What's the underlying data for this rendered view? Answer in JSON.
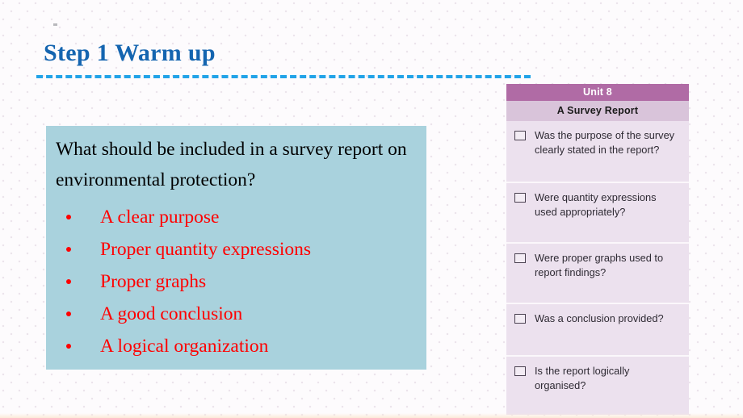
{
  "slide": {
    "title": "Step 1 Warm up",
    "colors": {
      "title_blue": "#1565b0",
      "rule_blue": "#22a3e8",
      "question_box_bg": "#a9d2dd",
      "bullet_red": "#ff0000",
      "panel_header_purple": "#b06ba5",
      "panel_subtitle_purple": "#d9c4da",
      "panel_body_purple": "#ece1ee"
    }
  },
  "question_box": {
    "question": "What should be included in a survey report on environmental protection?",
    "bullets": [
      "A clear purpose",
      "Proper quantity expressions",
      "Proper graphs",
      "A good conclusion",
      "A logical organization"
    ]
  },
  "checklist": {
    "unit_label": "Unit 8",
    "subtitle": "A Survey Report",
    "items": [
      {
        "text": "Was the purpose of the survey clearly stated in the report?",
        "checked": false,
        "lines": 3
      },
      {
        "text": "Were quantity expressions used appropriately?",
        "checked": false,
        "lines": 3
      },
      {
        "text": "Were proper graphs used to report findings?",
        "checked": false,
        "lines": 3
      },
      {
        "text": "Was a conclusion provided?",
        "checked": false,
        "lines": 2
      },
      {
        "text": "Is the report logically organised?",
        "checked": false,
        "lines": 2
      }
    ]
  }
}
